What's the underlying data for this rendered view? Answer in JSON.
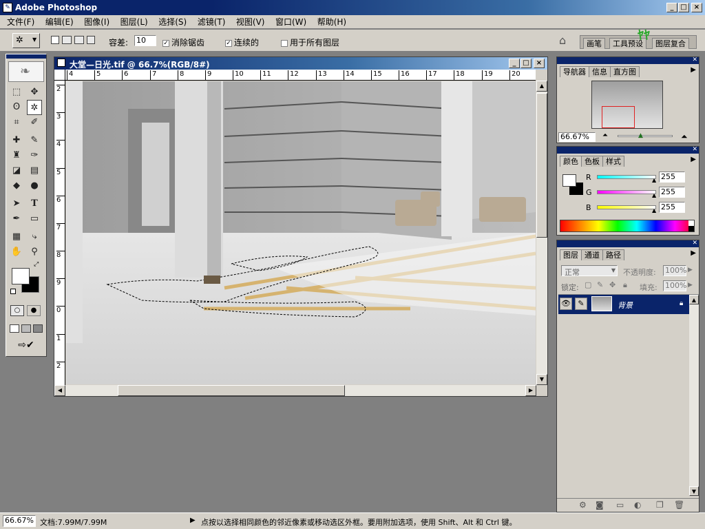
{
  "app": {
    "title": "Adobe Photoshop"
  },
  "menu": [
    "文件(F)",
    "编辑(E)",
    "图像(I)",
    "图层(L)",
    "选择(S)",
    "滤镜(T)",
    "视图(V)",
    "窗口(W)",
    "帮助(H)"
  ],
  "options": {
    "tolerance_label": "容差:",
    "tolerance_value": "10",
    "antialias_label": "消除锯齿",
    "contiguous_label": "连续的",
    "all_layers_label": "用于所有图层",
    "palette_tabs": [
      "画笔",
      "工具预设",
      "图层复合"
    ]
  },
  "document": {
    "title": "大堂—日光.tif @ 66.7%(RGB/8#)",
    "ruler_h": [
      "4",
      "5",
      "6",
      "7",
      "8",
      "9",
      "10",
      "11",
      "12",
      "13",
      "14",
      "15",
      "16",
      "17",
      "18",
      "19",
      "20"
    ],
    "ruler_v": [
      "2",
      "3",
      "4",
      "5",
      "6",
      "7",
      "8",
      "9",
      "0",
      "1",
      "2"
    ]
  },
  "navigator": {
    "tabs": [
      "导航器",
      "信息",
      "直方图"
    ],
    "zoom": "66.67%"
  },
  "color": {
    "tabs": [
      "颜色",
      "色板",
      "样式"
    ],
    "channels": [
      {
        "label": "R",
        "value": "255"
      },
      {
        "label": "G",
        "value": "255"
      },
      {
        "label": "B",
        "value": "255"
      }
    ]
  },
  "layers": {
    "tabs": [
      "图层",
      "通道",
      "路径"
    ],
    "blend_mode": "正常",
    "opacity_label": "不透明度:",
    "opacity_value": "100%",
    "lock_label": "锁定:",
    "fill_label": "填充:",
    "fill_value": "100%",
    "layer_name": "背景"
  },
  "status": {
    "zoom": "66.67%",
    "doc_size": "文档:7.99M/7.99M",
    "hint": "点按以选择相同颜色的邻近像素或移动选区外框。要用附加选项，使用 Shift、Alt 和 Ctrl 键。"
  }
}
